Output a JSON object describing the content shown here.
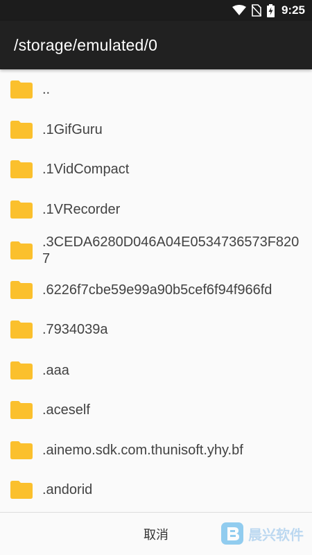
{
  "status_bar": {
    "time": "9:25",
    "icons": [
      "wifi-icon",
      "no-sim-icon",
      "battery-charging-icon"
    ]
  },
  "header": {
    "path": "/storage/emulated/0"
  },
  "folder_icon": {
    "name": "folder-icon",
    "color": "#fbc02d"
  },
  "items": [
    {
      "label": ".."
    },
    {
      "label": ".1GifGuru"
    },
    {
      "label": ".1VidCompact"
    },
    {
      "label": ".1VRecorder"
    },
    {
      "label": ".3CEDA6280D046A04E0534736573F8207"
    },
    {
      "label": ".6226f7cbe59e99a90b5cef6f94f966fd"
    },
    {
      "label": ".7934039a"
    },
    {
      "label": ".aaa"
    },
    {
      "label": ".aceself"
    },
    {
      "label": ".ainemo.sdk.com.thunisoft.yhy.bf"
    },
    {
      "label": ".andorid"
    }
  ],
  "footer": {
    "cancel_label": "取消",
    "watermark_text": "晨兴软件"
  },
  "colors": {
    "app_bar": "#212121",
    "status_bar": "#1c1c1c",
    "background": "#fafafa",
    "text": "#424242"
  }
}
